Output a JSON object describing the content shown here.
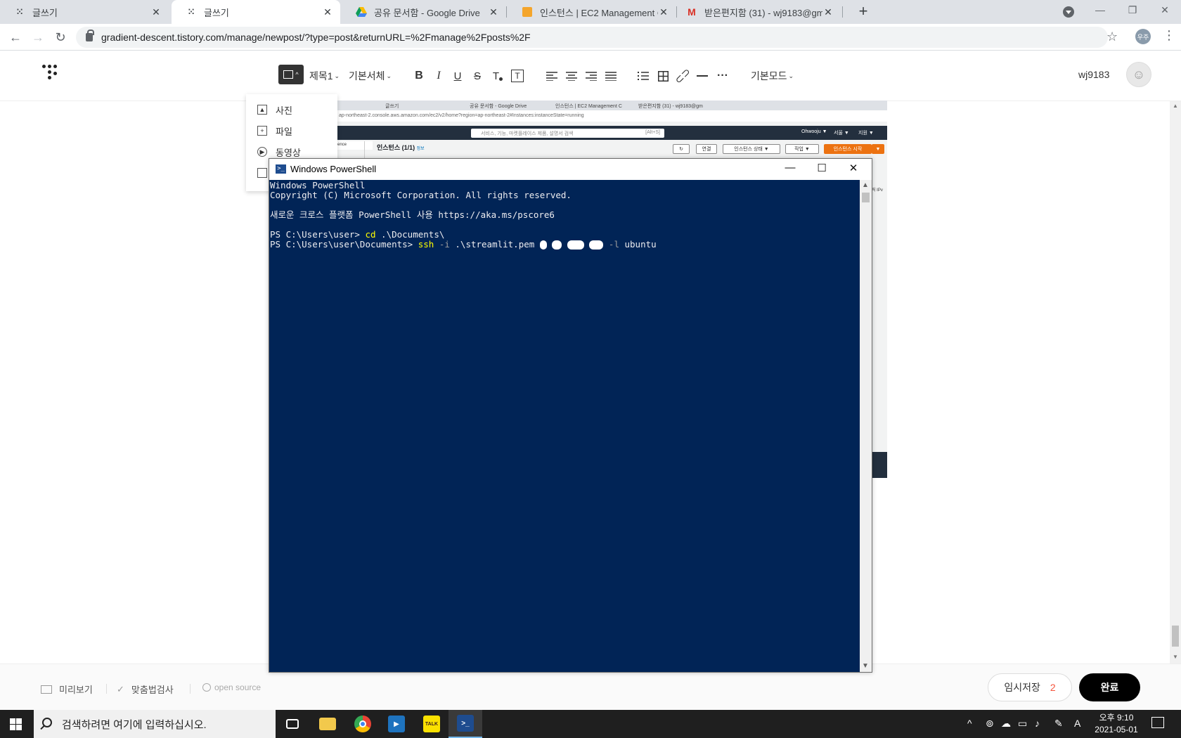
{
  "browser": {
    "tabs": [
      {
        "title": "글쓰기",
        "icon": "tistory-icon",
        "active": false
      },
      {
        "title": "글쓰기",
        "icon": "tistory-icon",
        "active": true
      },
      {
        "title": "공유 문서함 - Google Drive",
        "icon": "google-drive-icon",
        "active": false
      },
      {
        "title": "인스턴스 | EC2 Management Co",
        "icon": "aws-icon",
        "active": false
      },
      {
        "title": "받은편지함 (31) - wj9183@gmai",
        "icon": "gmail-icon",
        "active": false
      }
    ],
    "new_tab": "+",
    "url": "gradient-descent.tistory.com/manage/newpost/?type=post&returnURL=%2Fmanage%2Fposts%2F",
    "profile_label": "우주"
  },
  "editor": {
    "toolbar": {
      "heading": "제목1",
      "font": "기본서체",
      "bold": "B",
      "italic": "I",
      "underline": "U",
      "strike": "S",
      "textcolor": "T",
      "textbg": "T",
      "mode": "기본모드",
      "more": "···"
    },
    "username": "wj9183",
    "insert_menu": [
      {
        "label": "사진",
        "icon": "photo-icon"
      },
      {
        "label": "파일",
        "icon": "file-icon"
      },
      {
        "label": "동영상",
        "icon": "video-icon"
      }
    ]
  },
  "embedded_screenshot": {
    "tabs": [
      "글쓰기",
      "공유 문서함 - Google Drive",
      "인스턴스 | EC2 Management C",
      "받은편지함 (31) - wj9183@gm"
    ],
    "url": "ap-northeast-2.console.aws.amazon.com/ec2/v2/home?region=ap-northeast-2#Instances:instanceState=running",
    "search_placeholder": "서비스, 기능, 마켓플레이스 제품, 설명서 검색",
    "search_shortcut": "[Alt+S]",
    "user_menu": "Ohwooju ▼",
    "region_menu": "서울 ▼",
    "support_menu": "지원 ▼",
    "instances_title": "인스턴스 (1/1)",
    "info": "정보",
    "buttons": [
      "연결",
      "인스턴스 상태 ▼",
      "작업 ▼",
      "인스턴스 시작"
    ],
    "sidebar_fragment": "ence",
    "ip_fragment": "릭 IPv"
  },
  "powershell": {
    "title": "Windows PowerShell",
    "lines": {
      "l1": "Windows PowerShell",
      "l2": "Copyright (C) Microsoft Corporation. All rights reserved.",
      "l3": "새로운 크로스 플랫폼 PowerShell 사용 https://aka.ms/pscore6",
      "prompt1": "PS C:\\Users\\user> ",
      "cmd1": "cd",
      "arg1": " .\\Documents\\",
      "prompt2": "PS C:\\Users\\user\\Documents> ",
      "cmd2": "ssh",
      "flag_i": " -i",
      "arg2": " .\\streamlit.pem ",
      "flag_l": " -l",
      "arg3": " ubuntu"
    }
  },
  "bottom_bar": {
    "preview": "미리보기",
    "spellcheck": "맞춤법검사",
    "open_source": "open source",
    "temp_save": "임시저장",
    "temp_count": "2",
    "done": "완료"
  },
  "taskbar": {
    "search_placeholder": "검색하려면 여기에 입력하십시오.",
    "time": "오후 9:10",
    "date": "2021-05-01",
    "ime": "A"
  }
}
